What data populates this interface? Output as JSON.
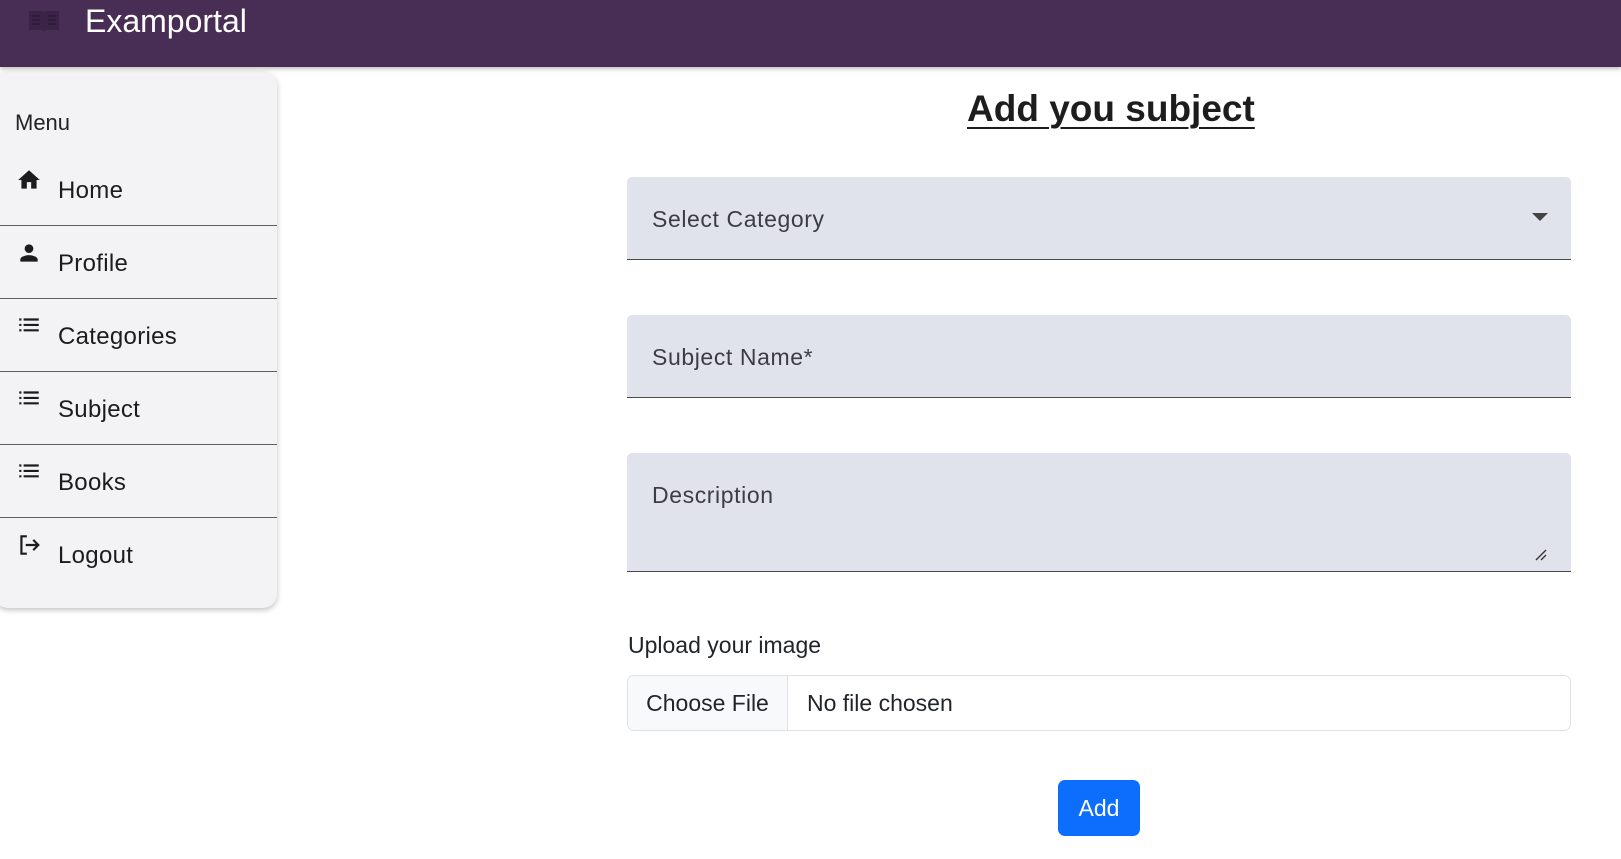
{
  "header": {
    "brand_icon": "book-icon",
    "title": "Examportal",
    "background_color": "#482d55"
  },
  "sidebar": {
    "menu_title": "Menu",
    "items": [
      {
        "label": "Home",
        "icon": "home-icon"
      },
      {
        "label": "Profile",
        "icon": "person-icon"
      },
      {
        "label": "Categories",
        "icon": "list-icon"
      },
      {
        "label": "Subject",
        "icon": "list-icon"
      },
      {
        "label": "Books",
        "icon": "list-icon"
      },
      {
        "label": "Logout",
        "icon": "logout-icon"
      }
    ]
  },
  "form": {
    "title": "Add you subject",
    "category_select": {
      "placeholder": "Select Category"
    },
    "subject_name": {
      "placeholder": "Subject Name*"
    },
    "description": {
      "placeholder": "Description"
    },
    "upload_label": "Upload your image",
    "file_button": "Choose File",
    "file_status": "No file chosen",
    "submit_label": "Add",
    "field_background": "#e1e3ec",
    "submit_color": "#0d6efd"
  }
}
